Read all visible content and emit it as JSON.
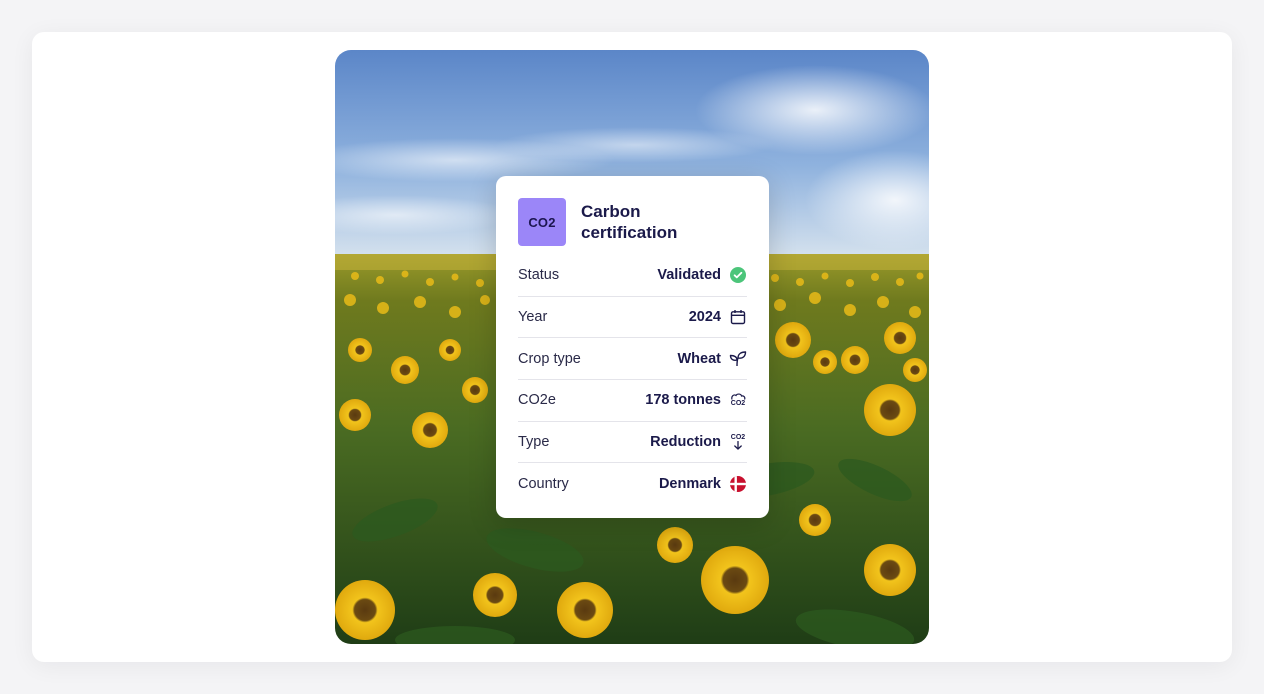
{
  "card": {
    "badge_text": "CO2",
    "title": "Carbon certification",
    "rows": [
      {
        "label": "Status",
        "value": "Validated",
        "icon": "check-circle-icon"
      },
      {
        "label": "Year",
        "value": "2024",
        "icon": "calendar-icon"
      },
      {
        "label": "Crop type",
        "value": "Wheat",
        "icon": "sprout-icon"
      },
      {
        "label": "CO2e",
        "value": "178 tonnes",
        "icon": "co2-cloud-icon",
        "icon_text": "CO2"
      },
      {
        "label": "Type",
        "value": "Reduction",
        "icon": "co2-down-icon",
        "icon_text": "CO2"
      },
      {
        "label": "Country",
        "value": "Denmark",
        "icon": "denmark-flag-icon"
      }
    ]
  },
  "colors": {
    "badge": "#9b86f8",
    "text_dark": "#1b1a4a",
    "check_green": "#4cc57a",
    "flag_red": "#c8102e"
  }
}
